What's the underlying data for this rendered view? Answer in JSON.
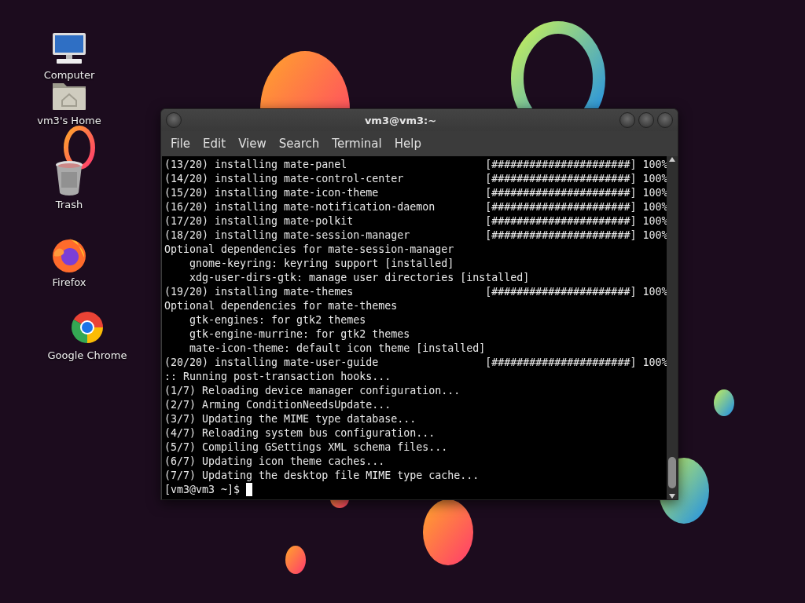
{
  "desktop_icons": [
    {
      "label": "Computer",
      "kind": "computer"
    },
    {
      "label": "vm3's Home",
      "kind": "home"
    },
    {
      "label": "Trash",
      "kind": "trash"
    },
    {
      "label": "Firefox",
      "kind": "firefox"
    },
    {
      "label": "Google Chrome",
      "kind": "chrome"
    }
  ],
  "window": {
    "title": "vm3@vm3:~",
    "menu": [
      "File",
      "Edit",
      "View",
      "Search",
      "Terminal",
      "Help"
    ]
  },
  "terminal": {
    "lines": [
      {
        "text": "(13/20) installing mate-panel",
        "progress": "[######################] 100%"
      },
      {
        "text": "(14/20) installing mate-control-center",
        "progress": "[######################] 100%"
      },
      {
        "text": "(15/20) installing mate-icon-theme",
        "progress": "[######################] 100%"
      },
      {
        "text": "(16/20) installing mate-notification-daemon",
        "progress": "[######################] 100%"
      },
      {
        "text": "(17/20) installing mate-polkit",
        "progress": "[######################] 100%"
      },
      {
        "text": "(18/20) installing mate-session-manager",
        "progress": "[######################] 100%"
      },
      {
        "text": "Optional dependencies for mate-session-manager"
      },
      {
        "text": "    gnome-keyring: keyring support [installed]"
      },
      {
        "text": "    xdg-user-dirs-gtk: manage user directories [installed]"
      },
      {
        "text": "(19/20) installing mate-themes",
        "progress": "[######################] 100%"
      },
      {
        "text": "Optional dependencies for mate-themes"
      },
      {
        "text": "    gtk-engines: for gtk2 themes"
      },
      {
        "text": "    gtk-engine-murrine: for gtk2 themes"
      },
      {
        "text": "    mate-icon-theme: default icon theme [installed]"
      },
      {
        "text": "(20/20) installing mate-user-guide",
        "progress": "[######################] 100%"
      },
      {
        "text": ":: Running post-transaction hooks..."
      },
      {
        "text": "(1/7) Reloading device manager configuration..."
      },
      {
        "text": "(2/7) Arming ConditionNeedsUpdate..."
      },
      {
        "text": "(3/7) Updating the MIME type database..."
      },
      {
        "text": "(4/7) Reloading system bus configuration..."
      },
      {
        "text": "(5/7) Compiling GSettings XML schema files..."
      },
      {
        "text": "(6/7) Updating icon theme caches..."
      },
      {
        "text": "(7/7) Updating the desktop file MIME type cache..."
      }
    ],
    "prompt": "[vm3@vm3 ~]$"
  }
}
